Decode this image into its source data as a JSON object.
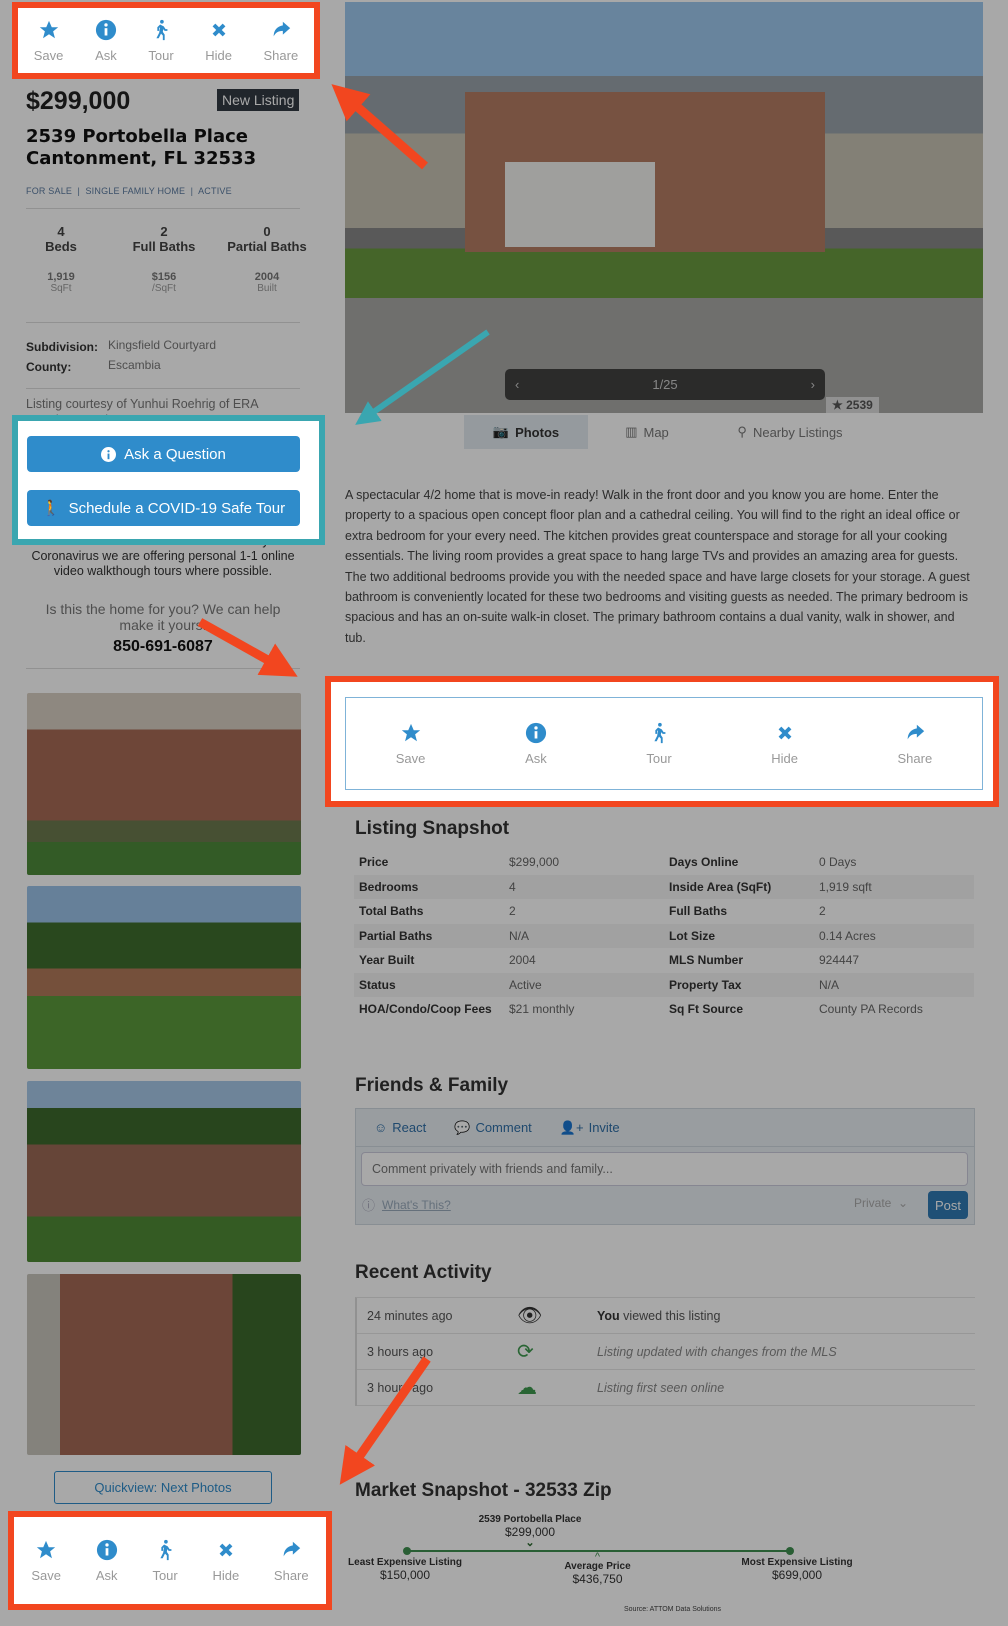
{
  "action_bar": {
    "items": [
      {
        "label": "Save",
        "icon": "star-icon"
      },
      {
        "label": "Ask",
        "icon": "info-icon"
      },
      {
        "label": "Tour",
        "icon": "walking-icon"
      },
      {
        "label": "Hide",
        "icon": "close-icon"
      },
      {
        "label": "Share",
        "icon": "share-icon"
      }
    ]
  },
  "listing": {
    "price": "$299,000",
    "badge": "New Listing",
    "address_line1": "2539 Portobella Place",
    "address_line2": "Cantonment, FL 32533",
    "meta": [
      "FOR SALE",
      "SINGLE FAMILY HOME",
      "ACTIVE"
    ],
    "stats": [
      {
        "value": "4",
        "label": "Beds",
        "sub_value": "1,919",
        "sub_label": "SqFt"
      },
      {
        "value": "2",
        "label": "Full Baths",
        "sub_value": "$156",
        "sub_label": "/SqFt"
      },
      {
        "value": "0",
        "label": "Partial Baths",
        "sub_value": "2004",
        "sub_label": "Built"
      }
    ],
    "subdivision_label": "Subdivision:",
    "subdivision": "Kingsfield Courtyard",
    "county_label": "County:",
    "county": "Escambia",
    "courtesy": "Listing courtesy of Yunhui Roehrig of ERA American Real Estate"
  },
  "cta": {
    "ask": "Ask a Question",
    "tour": "Schedule a COVID-19 Safe Tour",
    "covid_note": "Due to the health concerns created by Coronavirus we are offering personal 1-1 online video walkthough tours where possible.",
    "prompt": "Is this the home for you? We can help make it yours.",
    "phone": "850-691-6087",
    "quickview": "Quickview: Next Photos"
  },
  "gallery": {
    "counter": "1/25",
    "house_number": "2539",
    "tabs": [
      "Photos",
      "Map",
      "Nearby Listings"
    ],
    "active_tab": "Photos"
  },
  "description": "A spectacular 4/2 home that is move-in ready! Walk in the front door and you know you are home. Enter the property to a spacious open concept floor plan and a cathedral ceiling. You will find to the right an ideal office or extra bedroom for your every need. The kitchen provides great counterspace and storage for all your cooking essentials. The living room provides a great space to hang large TVs and provides an amazing area for guests. The two additional bedrooms provide you with the needed space and have large closets for your storage. A guest bathroom is conveniently located for these two bedrooms and visiting guests as needed. The primary bedroom is spacious and has an on-suite walk-in closet. The primary bathroom contains a dual vanity, walk in shower, and tub.",
  "snapshot": {
    "title": "Listing Snapshot",
    "rows": [
      [
        "Price",
        "$299,000",
        "Days Online",
        "0 Days"
      ],
      [
        "Bedrooms",
        "4",
        "Inside Area (SqFt)",
        "1,919 sqft"
      ],
      [
        "Total Baths",
        "2",
        "Full Baths",
        "2"
      ],
      [
        "Partial Baths",
        "N/A",
        "Lot Size",
        "0.14 Acres"
      ],
      [
        "Year Built",
        "2004",
        "MLS Number",
        "924447"
      ],
      [
        "Status",
        "Active",
        "Property Tax",
        "N/A"
      ],
      [
        "HOA/Condo/Coop Fees",
        "$21 monthly",
        "Sq Ft Source",
        "County PA Records"
      ]
    ]
  },
  "friends": {
    "title": "Friends & Family",
    "react": "React",
    "comment": "Comment",
    "invite": "Invite",
    "placeholder": "Comment privately with friends and family...",
    "whats_this": "What's This?",
    "privacy": "Private",
    "post": "Post"
  },
  "activity": {
    "title": "Recent Activity",
    "rows": [
      {
        "time": "24 minutes ago",
        "icon": "eye-icon",
        "bold": "You",
        "text": " viewed this listing",
        "italic": false
      },
      {
        "time": "3 hours ago",
        "icon": "refresh-icon",
        "bold": "",
        "text": "Listing updated with changes from the MLS",
        "italic": true
      },
      {
        "time": "3 hours ago",
        "icon": "cloud-upload-icon",
        "bold": "",
        "text": "Listing first seen online",
        "italic": true
      }
    ]
  },
  "market": {
    "title": "Market Snapshot - 32533 Zip",
    "this_label": "2539 Portobella Place",
    "this_value": "$299,000",
    "min_label": "Least Expensive Listing",
    "min_value": "$150,000",
    "avg_label": "Average Price",
    "avg_value": "$436,750",
    "max_label": "Most Expensive Listing",
    "max_value": "$699,000",
    "source": "Source: ATTOM Data Solutions"
  },
  "colors": {
    "accent": "#2f8ccb",
    "highlight_red": "#f2461f",
    "highlight_teal": "#3aa6b0",
    "market_green": "#3f8f4f"
  }
}
